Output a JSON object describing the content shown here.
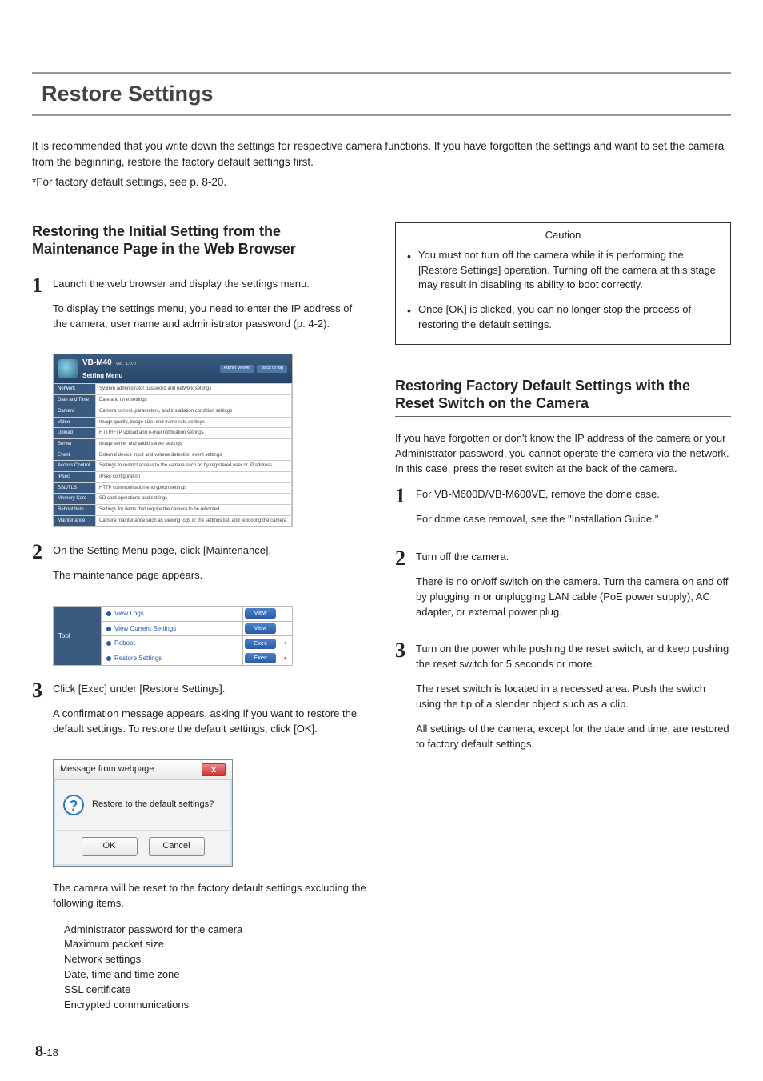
{
  "title": "Restore Settings",
  "intro": "It is recommended that you write down the settings for respective camera functions. If you have forgotten the settings and want to set the camera from the beginning, restore the factory default settings first.",
  "intro_note": "*For factory default settings, see p. 8-20.",
  "left": {
    "heading": "Restoring the Initial Setting from the Maintenance Page in the Web Browser",
    "step1": {
      "num": "1",
      "text": "Launch the web browser and display the settings menu.",
      "sub": "To display the settings menu, you need to enter the IP address of the camera, user name and administrator password (p. 4-2)."
    },
    "settings_menu": {
      "model": "VB-M40",
      "ver": "Ver. 1.0.0",
      "menu_label": "Setting Menu",
      "btn1": "Admin Viewer",
      "btn2": "Back to top",
      "rows": [
        {
          "k": "Network",
          "v": "System administrator password and network settings"
        },
        {
          "k": "Date and Time",
          "v": "Date and time settings"
        },
        {
          "k": "Camera",
          "v": "Camera control, parameters, and installation condition settings"
        },
        {
          "k": "Video",
          "v": "Image quality, image size, and frame rate settings"
        },
        {
          "k": "Upload",
          "v": "HTTP/FTP upload and e-mail notification settings"
        },
        {
          "k": "Server",
          "v": "Image server and audio server settings"
        },
        {
          "k": "Event",
          "v": "External device input and volume detection event settings"
        },
        {
          "k": "Access Control",
          "v": "Settings to restrict access to the camera such as by registered user or IP address"
        },
        {
          "k": "IPsec",
          "v": "IPsec configuration"
        },
        {
          "k": "SSL/TLS",
          "v": "HTTP communication encryption settings"
        },
        {
          "k": "Memory Card",
          "v": "SD card operations and settings"
        },
        {
          "k": "Reboot Item",
          "v": "Settings for items that require the camera to be rebooted"
        },
        {
          "k": "Maintenance",
          "v": "Camera maintenance such as viewing logs or the settings list, and rebooting the camera"
        }
      ]
    },
    "step2": {
      "num": "2",
      "text": "On the Setting Menu page, click [Maintenance].",
      "sub": "The maintenance page appears."
    },
    "tool_table": {
      "lead": "Tool",
      "rows": [
        {
          "name": "View Logs",
          "btn": "View",
          "dot": ""
        },
        {
          "name": "View Current Settings",
          "btn": "View",
          "dot": ""
        },
        {
          "name": "Reboot",
          "btn": "Exec",
          "dot": "•"
        },
        {
          "name": "Restore Settings",
          "btn": "Exec",
          "dot": "•"
        }
      ]
    },
    "step3": {
      "num": "3",
      "text": "Click [Exec] under [Restore Settings].",
      "sub": "A confirmation message appears, asking if you want to restore the default settings.  To restore the default settings, click [OK]."
    },
    "dialog": {
      "title": "Message from webpage",
      "body": "Restore to the default settings?",
      "ok": "OK",
      "cancel": "Cancel"
    },
    "after_dialog": "The camera will be reset to the factory default settings excluding the following items.",
    "excluded": [
      "Administrator password for the camera",
      "Maximum packet size",
      "Network settings",
      "Date, time and time zone",
      "SSL certificate",
      "Encrypted communications"
    ]
  },
  "right": {
    "caution_title": "Caution",
    "caution_items": [
      "You must not turn off the camera while it is performing the [Restore Settings] operation. Turning off the camera at this stage may result in disabling its ability to boot correctly.",
      "Once [OK] is clicked, you can no longer stop the process of restoring the default settings."
    ],
    "heading": "Restoring Factory Default Settings with the Reset Switch on the Camera",
    "intro": "If you have forgotten or don't know the IP address of the camera or your Administrator password, you cannot operate the camera via the network. In this case, press the reset switch at the back of the camera.",
    "step1": {
      "num": "1",
      "text": "For VB-M600D/VB-M600VE, remove the dome case.",
      "sub": "For dome case removal, see the \"Installation Guide.\""
    },
    "step2": {
      "num": "2",
      "text": "Turn off the camera.",
      "sub": "There is no on/off switch on the camera. Turn the camera on and off by plugging in or unplugging LAN cable (PoE power supply), AC adapter, or external power plug."
    },
    "step3": {
      "num": "3",
      "text": "Turn on the power while pushing the reset switch, and keep pushing the reset switch for 5 seconds or more.",
      "sub1": "The reset switch is located in a recessed area. Push the switch using the tip of a slender object such as a clip.",
      "sub2": "All settings of the camera, except for the date and time, are restored to factory default settings."
    }
  },
  "page": {
    "chapter": "8",
    "sep": "-",
    "num": "18"
  }
}
